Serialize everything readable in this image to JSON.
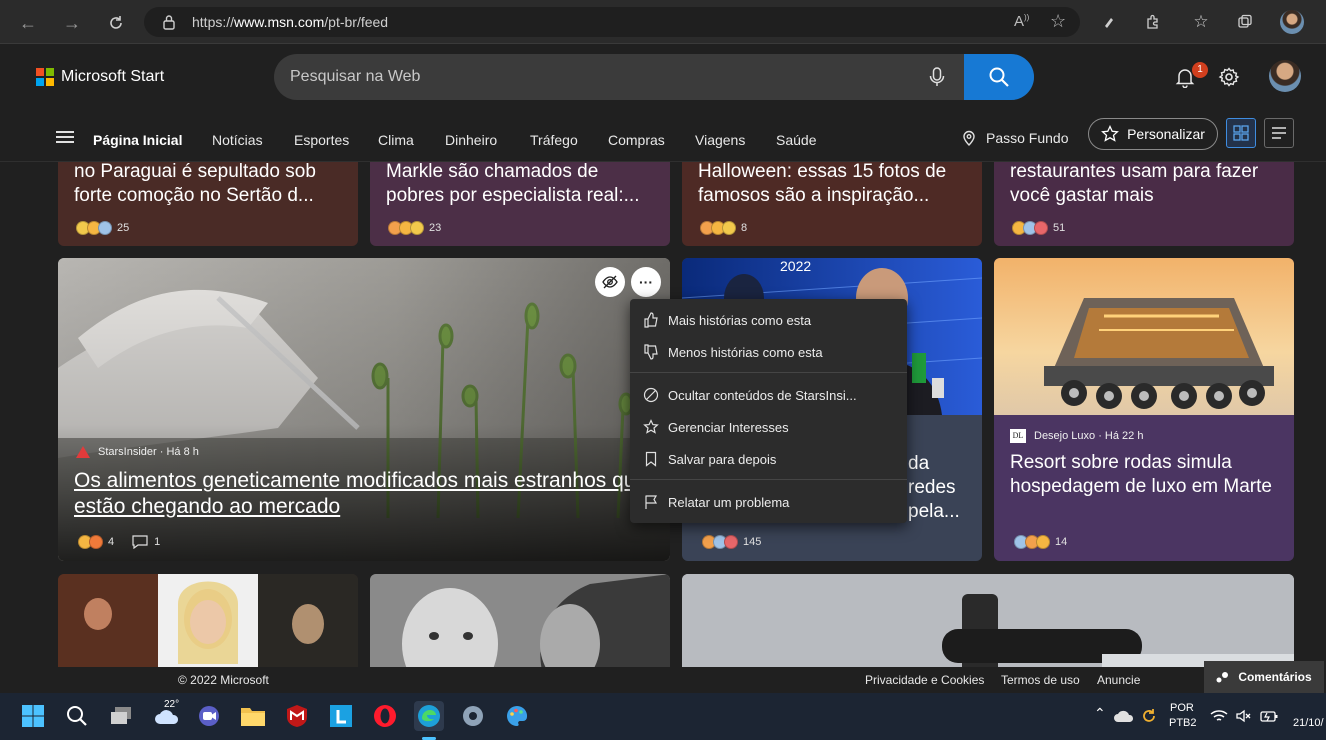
{
  "browser": {
    "url_prefix": "https://",
    "url_domain": "www.msn.com",
    "url_path": "/pt-br/feed"
  },
  "header": {
    "brand": "Microsoft Start",
    "search_placeholder": "Pesquisar na Web",
    "notification_count": "1",
    "brand_colors": [
      "#f25022",
      "#7fba00",
      "#00a4ef",
      "#ffb900"
    ],
    "accent": "#1779d4"
  },
  "nav": {
    "items": [
      "Página Inicial",
      "Notícias",
      "Esportes",
      "Clima",
      "Dinheiro",
      "Tráfego",
      "Compras",
      "Viagens",
      "Saúde"
    ],
    "location": "Passo Fundo",
    "personalize": "Personalizar"
  },
  "feed": {
    "top_cards": [
      {
        "title": "no Paraguai é sepultado sob forte comoção no Sertão d...",
        "reactions": "25"
      },
      {
        "title": "Markle são chamados de pobres por especialista real:...",
        "reactions": "23"
      },
      {
        "title": "Halloween: essas 15 fotos de famosos são a inspiração...",
        "reactions": "8"
      },
      {
        "title": "restaurantes usam para fazer você gastar mais",
        "reactions": "51"
      }
    ],
    "main_card": {
      "source": "StarsInsider · Há 8 h",
      "title": "Os alimentos geneticamente modificados mais estranhos que estão chegando ao mercado",
      "reactions": "4",
      "comments": "1"
    },
    "news_card": {
      "year_label": "2022",
      "title_fragments": [
        "da",
        "redes",
        "pela..."
      ],
      "reactions": "145"
    },
    "luxury_card": {
      "source": "Desejo Luxo · Há 22 h",
      "source_logo": "DL",
      "title": "Resort sobre rodas simula hospedagem de luxo em Marte",
      "reactions": "14"
    }
  },
  "context_menu": {
    "items": [
      "Mais histórias como esta",
      "Menos histórias como esta",
      "Ocultar conteúdos de StarsInsi...",
      "Gerenciar Interesses",
      "Salvar para depois",
      "Relatar um problema"
    ]
  },
  "footer": {
    "copyright": "© 2022 Microsoft",
    "links": [
      "Privacidade e Cookies",
      "Termos de uso",
      "Anuncie"
    ],
    "feedback": "Comentários"
  },
  "taskbar": {
    "temperature": "22°",
    "language": "POR",
    "keyboard": "PTB2",
    "date": "21/10/"
  }
}
